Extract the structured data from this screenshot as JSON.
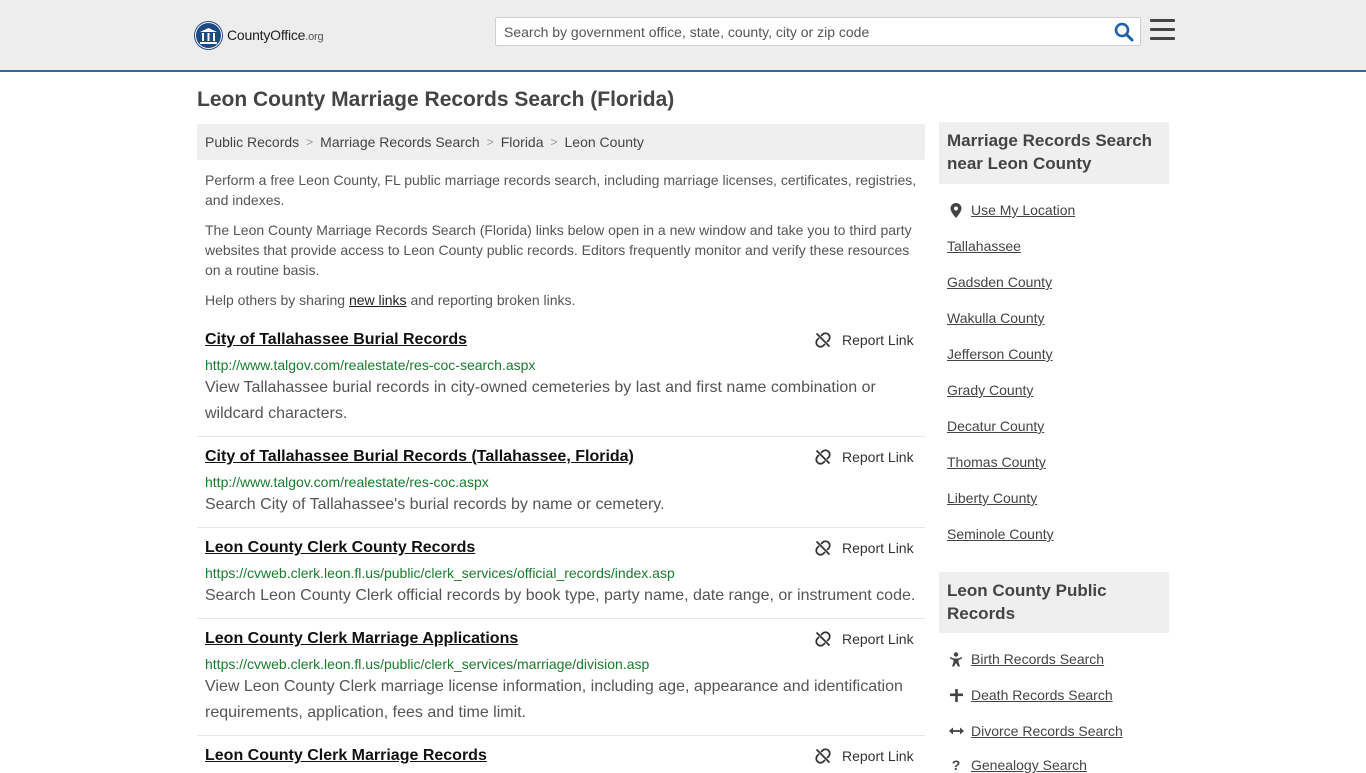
{
  "header": {
    "logo_main": "CountyOffice",
    "logo_org": ".org",
    "search_placeholder": "Search by government office, state, county, city or zip code"
  },
  "page_title": "Leon County Marriage Records Search (Florida)",
  "breadcrumb": [
    "Public Records",
    "Marriage Records Search",
    "Florida",
    "Leon County"
  ],
  "intro": {
    "p1": "Perform a free Leon County, FL public marriage records search, including marriage licenses, certificates, registries, and indexes.",
    "p2": "The Leon County Marriage Records Search (Florida) links below open in a new window and take you to third party websites that provide access to Leon County public records. Editors frequently monitor and verify these resources on a routine basis.",
    "p3_before": "Help others by sharing ",
    "p3_link": "new links",
    "p3_after": " and reporting broken links."
  },
  "report_label": "Report Link",
  "results": [
    {
      "title": "City of Tallahassee Burial Records",
      "url": "http://www.talgov.com/realestate/res-coc-search.aspx",
      "desc": "View Tallahassee burial records in city-owned cemeteries by last and first name combination or wildcard characters."
    },
    {
      "title": "City of Tallahassee Burial Records (Tallahassee, Florida)",
      "url": "http://www.talgov.com/realestate/res-coc.aspx",
      "desc": "Search City of Tallahassee's burial records by name or cemetery."
    },
    {
      "title": "Leon County Clerk County Records",
      "url": "https://cvweb.clerk.leon.fl.us/public/clerk_services/official_records/index.asp",
      "desc": "Search Leon County Clerk official records by book type, party name, date range, or instrument code."
    },
    {
      "title": "Leon County Clerk Marriage Applications",
      "url": "https://cvweb.clerk.leon.fl.us/public/clerk_services/marriage/division.asp",
      "desc": "View Leon County Clerk marriage license information, including age, appearance and identification requirements, application, fees and time limit."
    },
    {
      "title": "Leon County Clerk Marriage Records",
      "url": "",
      "desc": ""
    }
  ],
  "sidebar": {
    "nearby_heading": "Marriage Records Search near Leon County",
    "use_location": "Use My Location",
    "nearby": [
      "Tallahassee",
      "Gadsden County",
      "Wakulla County",
      "Jefferson County",
      "Grady County",
      "Decatur County",
      "Thomas County",
      "Liberty County",
      "Seminole County"
    ],
    "public_heading": "Leon County Public Records",
    "public_links": [
      {
        "label": "Birth Records Search",
        "icon": "baby-icon"
      },
      {
        "label": "Death Records Search",
        "icon": "cross-icon"
      },
      {
        "label": "Divorce Records Search",
        "icon": "arrows-horizontal-icon"
      },
      {
        "label": "Genealogy Search",
        "icon": "question-icon"
      }
    ]
  },
  "colors": {
    "header_bg": "#ededed",
    "header_border": "#2f68a8",
    "url_green": "#1b7a2e",
    "search_icon_blue": "#1d5fa8"
  }
}
